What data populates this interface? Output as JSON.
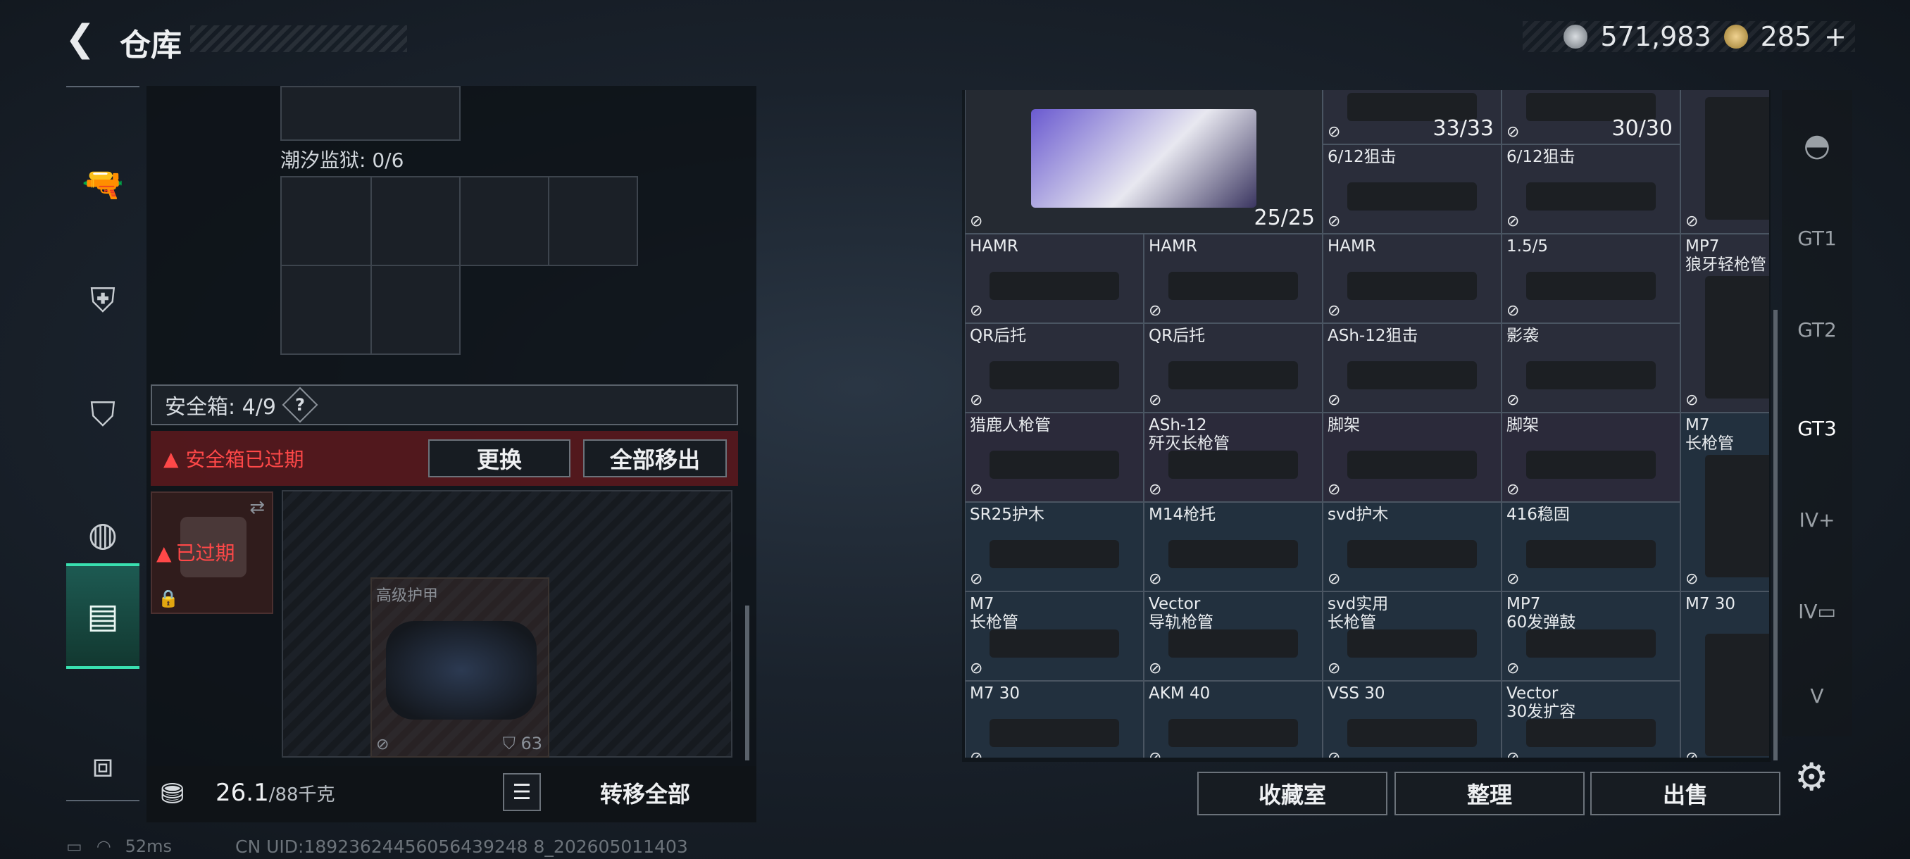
{
  "header": {
    "title": "仓库",
    "currency_a": "571,983",
    "currency_b": "285",
    "currency_b_plus": "+"
  },
  "left_nav": [
    "pistol-icon",
    "vest-icon",
    "backpack-armor-icon",
    "backpack-icon",
    "safe-case-icon",
    "toolbox-icon"
  ],
  "left": {
    "container_label": "潮汐监狱: 0/6",
    "safe_title": "安全箱: 4/9",
    "help": "?",
    "alert_text": "安全箱已过期",
    "replace_button": "更换",
    "remove_all_button": "全部移出",
    "expired_label": "已过期",
    "armor_label": "高级护甲",
    "armor_durability": "63",
    "weight_value": "26.1",
    "weight_max": "/88千克",
    "transfer_all_button": "转移全部"
  },
  "inventory": {
    "items": [
      {
        "name": "",
        "count": "25/25",
        "tint": "#252a32"
      },
      {
        "name": "",
        "count": "33/33",
        "tint": "#2a2d3a"
      },
      {
        "name": "",
        "count": "30/30",
        "tint": "#2a2d3a"
      },
      {
        "name": "6/12狙击",
        "tint": "#2a2d3a"
      },
      {
        "name": "6/12狙击",
        "tint": "#2a2d3a"
      },
      {
        "name": "",
        "tint": "#2a2d3a"
      },
      {
        "name": "HAMR",
        "tint": "#2a2d3a"
      },
      {
        "name": "HAMR",
        "tint": "#2a2d3a"
      },
      {
        "name": "HAMR",
        "tint": "#2a2d3a"
      },
      {
        "name": "1.5/5",
        "tint": "#2a2d3a"
      },
      {
        "name": "MP7\n狼牙轻枪管",
        "tint": "#2a2d3a"
      },
      {
        "name": "QR后托",
        "tint": "#2a2d3a"
      },
      {
        "name": "QR后托",
        "tint": "#2a2d3a"
      },
      {
        "name": "ASh-12狙击",
        "tint": "#2a2d3a"
      },
      {
        "name": "影袭",
        "tint": "#2a2d3a"
      },
      {
        "name": "猎鹿人枪管",
        "tint": "#2b2a3a"
      },
      {
        "name": "ASh-12\n歼灭长枪管",
        "tint": "#2b2a3a"
      },
      {
        "name": "脚架",
        "tint": "#2b2a3a"
      },
      {
        "name": "脚架",
        "tint": "#2b2a3a"
      },
      {
        "name": "M7\n长枪管",
        "tint": "#22303e"
      },
      {
        "name": "SR25护木",
        "tint": "#22303e"
      },
      {
        "name": "M14枪托",
        "tint": "#22303e"
      },
      {
        "name": "svd护木",
        "tint": "#22303e"
      },
      {
        "name": "416稳固",
        "tint": "#22303e"
      },
      {
        "name": "M7\n长枪管",
        "tint": "#22303e"
      },
      {
        "name": "Vector\n导轨枪管",
        "tint": "#22303e"
      },
      {
        "name": "svd实用\n长枪管",
        "tint": "#22303e"
      },
      {
        "name": "MP7\n60发弹鼓",
        "tint": "#22303e"
      },
      {
        "name": "M7 30",
        "tint": "#22303e"
      },
      {
        "name": "M7 30",
        "tint": "#22303e"
      },
      {
        "name": "AKM 40",
        "tint": "#22303e"
      },
      {
        "name": "VSS 30",
        "tint": "#22303e"
      },
      {
        "name": "Vector\n30发扩容",
        "tint": "#22303e"
      }
    ]
  },
  "right_nav": [
    "helmet-icon",
    "gt1-icon",
    "gt2-icon",
    "gt3-icon",
    "iv-plus-icon",
    "iv-folder-icon",
    "v-icon"
  ],
  "bottom_buttons": {
    "collection": "收藏室",
    "sort": "整理",
    "sell": "出售"
  },
  "status": {
    "ping": "52ms",
    "uid": "CN UID:18923624456056439248 8_202605011403"
  }
}
